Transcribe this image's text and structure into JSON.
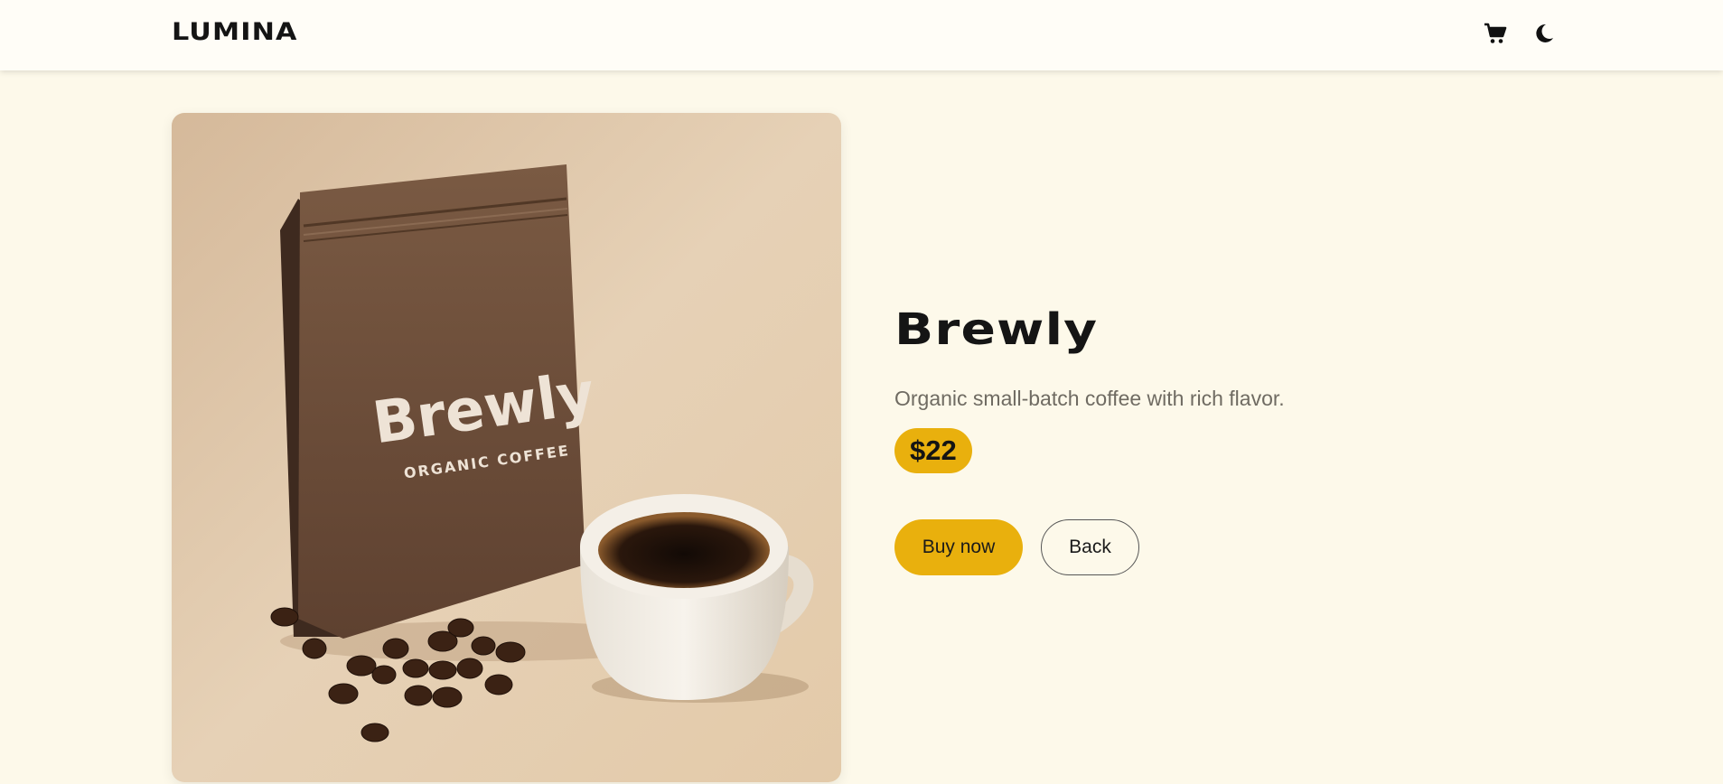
{
  "header": {
    "logo": "LUMINA",
    "cart_icon": "cart-icon",
    "theme_icon": "moon-icon"
  },
  "product": {
    "image_alt": "Brewly coffee bag with cup of coffee",
    "bag_brand": "Brewly",
    "bag_subtitle": "ORGANIC COFFEE",
    "title": "Brewly",
    "description": "Organic small-batch coffee with rich flavor.",
    "price": "$22"
  },
  "actions": {
    "buy_label": "Buy now",
    "back_label": "Back"
  },
  "colors": {
    "background": "#fdf9ea",
    "accent": "#e9b00d",
    "text": "#1a1a1a"
  }
}
